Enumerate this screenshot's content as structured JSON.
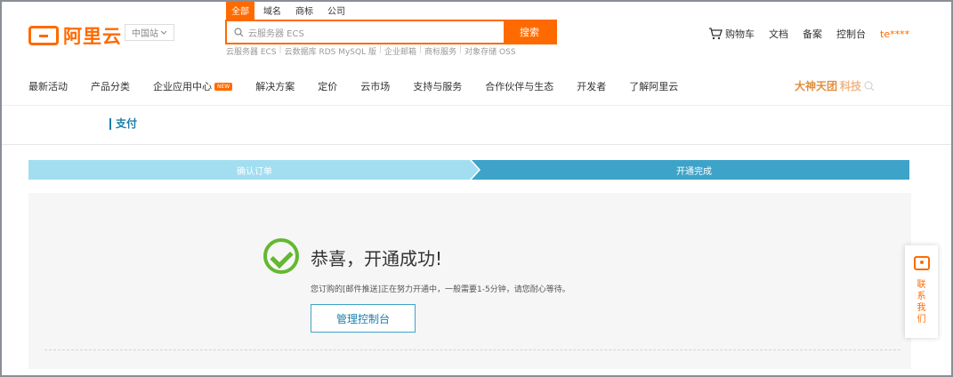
{
  "header": {
    "logo_text": "阿里云",
    "region": "中国站",
    "search": {
      "tabs": [
        "全部",
        "域名",
        "商标",
        "公司"
      ],
      "placeholder": "云服务器 ECS",
      "button": "搜索",
      "hot": [
        "云服务器 ECS",
        "云数据库 RDS MySQL 版",
        "企业邮箱",
        "商标服务",
        "对象存储 OSS"
      ]
    },
    "links": {
      "cart": "购物车",
      "docs": "文档",
      "beian": "备案",
      "console": "控制台",
      "user": "te****"
    }
  },
  "nav": {
    "items": [
      "最新活动",
      "产品分类",
      "企业应用中心",
      "解决方案",
      "定价",
      "云市场",
      "支持与服务",
      "合作伙伴与生态",
      "开发者",
      "了解阿里云"
    ],
    "new_badge": "NEW",
    "brand": "大神天团",
    "brand_fade": "科技"
  },
  "page": {
    "title": "支付",
    "steps": [
      "确认订单",
      "开通完成"
    ],
    "success_title": "恭喜，开通成功!",
    "success_desc": "您订购的[邮件推送]正在努力开通中，一般需要1-5分钟，请您耐心等待。",
    "console_button": "管理控制台"
  },
  "contact": {
    "label": "联系我们"
  },
  "colors": {
    "brand": "#ff6a00",
    "step_done": "#a3def0",
    "step_active": "#3ea3c8",
    "success": "#63b830"
  }
}
